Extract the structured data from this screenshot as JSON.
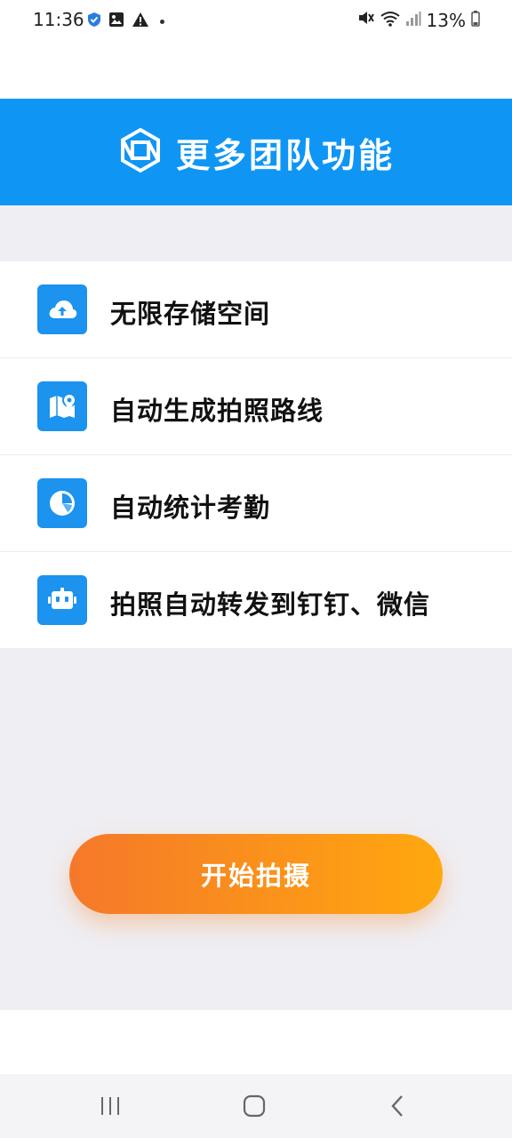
{
  "status_bar": {
    "time": "11:36",
    "battery": "13%",
    "left_icons": [
      "shield-check-icon",
      "image-icon",
      "warning-icon",
      "dot-icon"
    ],
    "right_icons": [
      "mute-icon",
      "wifi-icon",
      "signal-icon",
      "battery-icon"
    ]
  },
  "banner": {
    "title": "更多团队功能",
    "icon": "hexagon-logo-icon",
    "color": "#0f96f5"
  },
  "features": [
    {
      "label": "无限存储空间",
      "icon": "cloud-upload-icon"
    },
    {
      "label": "自动生成拍照路线",
      "icon": "map-pin-icon"
    },
    {
      "label": "自动统计考勤",
      "icon": "pie-chart-icon"
    },
    {
      "label": "拍照自动转发到钉钉、微信",
      "icon": "robot-icon"
    }
  ],
  "start_button": {
    "label": "开始拍摄",
    "gradient": [
      "#f5782a",
      "#ffa80e"
    ]
  },
  "nav_bar": {
    "buttons": [
      "recent-apps-icon",
      "home-icon",
      "back-icon"
    ]
  }
}
